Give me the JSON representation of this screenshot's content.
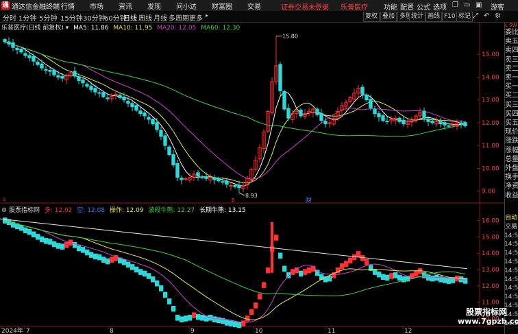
{
  "titlebar": {
    "app_name": "通达信金融终端",
    "menus": [
      "行情",
      "市场",
      "资讯",
      "发现",
      "问小达",
      "财富圈",
      "交易"
    ],
    "login_notice": "证券交易未登录",
    "stock_name": "乐普医疗",
    "right_menus": [
      "功能",
      "配置",
      "公式",
      "选项"
    ],
    "guest": "游客"
  },
  "toolbar": {
    "periods": [
      "分时",
      "1分钟",
      "5分钟",
      "15分钟",
      "30分钟",
      "60分钟",
      "日线",
      "周线",
      "月线",
      "多周期",
      "更多"
    ],
    "active_period": "日线",
    "buttons": [
      "复权",
      "叠加",
      "多股",
      "统计",
      "画线",
      "F10",
      "标记"
    ],
    "icons": [
      "expand-icon",
      "back-icon",
      "settings-icon"
    ]
  },
  "main_info": {
    "title": "乐普医疗(日线 前复权)",
    "ma5": "MA5: 11.86",
    "ma10": "MA10: 11.95",
    "ma20": "MA20: 12.05",
    "ma60": "MA60: 12.30"
  },
  "sub_info": {
    "title": "股票指标网",
    "duo": "多: 12.02",
    "kong": "空: 12.08",
    "caozuo": "操作: 12.09",
    "boduan": "波段牛熊: 12.27",
    "changqi": "长期牛熊: 13.15"
  },
  "sidebar": {
    "top": [
      "委比",
      "卖五",
      "卖四",
      "卖三",
      "卖二",
      "卖一",
      "买一",
      "买二",
      "买三",
      "买四",
      "买五",
      "现价",
      "涨跌",
      "涨幅",
      "总量",
      "外盘",
      "换手",
      "净资",
      "收益"
    ],
    "bottom": [
      "自动",
      "交易",
      "14:50",
      "14:50",
      "14:50",
      "14:50",
      "14:50",
      "14:50",
      "14:50",
      "14:50",
      "14:50",
      "14:50",
      "14:50"
    ]
  },
  "price_axis": {
    "main": [
      "15.00",
      "14.00",
      "13.00",
      "12.00",
      "11.00",
      "10.00",
      "9.00"
    ],
    "sub": [
      "16.00",
      "15.00",
      "14.00",
      "13.00",
      "12.00",
      "11.00",
      "10.00"
    ]
  },
  "annotations": {
    "high": "15.80",
    "low": "8.93",
    "marker_top": "财",
    "marker_s": "S",
    "marker_b": "B"
  },
  "date_axis": [
    "2024年",
    "7",
    "8",
    "9",
    "10",
    "11",
    "12"
  ],
  "watermark": {
    "line1": "股票指标网",
    "line2": "www.7gpzb.com"
  },
  "colors": {
    "up": "#ff3030",
    "down": "#2ed8d8",
    "ma5": "#ffffff",
    "ma10": "#e6e64c",
    "ma20": "#d040d0",
    "ma60": "#3cd23c",
    "accent": "#ff3a3a"
  },
  "chart_data": {
    "type": "candlestick",
    "title": "乐普医疗(日线 前复权)",
    "series": [
      {
        "name": "MA5",
        "latest": 11.86
      },
      {
        "name": "MA10",
        "latest": 11.95
      },
      {
        "name": "MA20",
        "latest": 12.05
      },
      {
        "name": "MA60",
        "latest": 12.3
      }
    ],
    "ylim": [
      8.6,
      16.0
    ],
    "x_ticks": [
      "7",
      "8",
      "9",
      "10",
      "11",
      "12"
    ],
    "closes": [
      15.55,
      15.45,
      15.3,
      15.2,
      15.1,
      14.95,
      14.85,
      14.7,
      14.55,
      14.4,
      14.3,
      14.25,
      14.1,
      14.0,
      13.95,
      14.05,
      14.2,
      14.05,
      13.85,
      13.75,
      13.6,
      13.45,
      13.35,
      13.3,
      13.15,
      13.05,
      13.15,
      13.25,
      13.1,
      13.0,
      12.85,
      12.7,
      12.55,
      12.4,
      12.3,
      12.15,
      11.95,
      11.7,
      11.4,
      11.0,
      10.6,
      10.15,
      9.6,
      9.5,
      9.55,
      9.6,
      9.75,
      9.65,
      9.6,
      9.55,
      9.6,
      9.5,
      9.45,
      9.4,
      9.3,
      9.25,
      9.2,
      9.15,
      9.25,
      9.55,
      9.95,
      10.35,
      10.9,
      11.6,
      12.5,
      13.8,
      14.5,
      13.4,
      12.6,
      12.2,
      12.4,
      12.5,
      12.3,
      12.4,
      12.5,
      12.6,
      12.35,
      12.1,
      11.95,
      12.0,
      12.2,
      12.5,
      12.75,
      12.9,
      13.1,
      13.3,
      13.5,
      13.25,
      13.0,
      12.65,
      12.4,
      12.25,
      12.1,
      12.05,
      12.15,
      12.2,
      12.05,
      11.95,
      12.0,
      12.15,
      12.3,
      12.45,
      12.2,
      12.05,
      12.0,
      12.05,
      11.95,
      11.9,
      11.85,
      11.9,
      12.0,
      11.95,
      11.86
    ],
    "high": 15.8,
    "low": 8.93
  }
}
